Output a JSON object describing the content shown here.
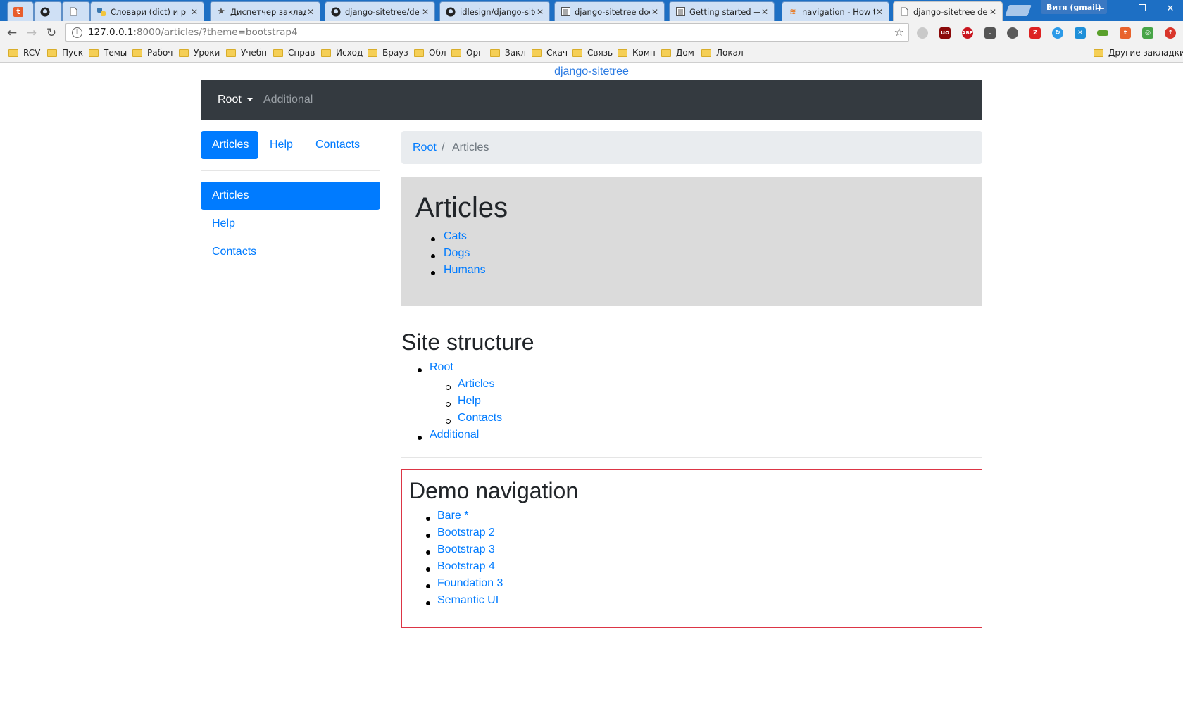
{
  "browser": {
    "tabs": [
      {
        "title": "",
        "icon": "t"
      },
      {
        "title": "",
        "icon": "github"
      },
      {
        "title": "",
        "icon": "page"
      },
      {
        "title": "Словари (dict) и р",
        "icon": "python"
      },
      {
        "title": "Диспетчер заклад",
        "icon": "star"
      },
      {
        "title": "django-sitetree/de",
        "icon": "github"
      },
      {
        "title": "idlesign/django-site",
        "icon": "github"
      },
      {
        "title": "django-sitetree doc",
        "icon": "doc"
      },
      {
        "title": "Getting started — c",
        "icon": "doc"
      },
      {
        "title": "navigation - How t",
        "icon": "stack"
      },
      {
        "title": "django-sitetree dei",
        "icon": "page"
      }
    ],
    "profile_label": "Витя (gmail)",
    "window_controls": {
      "minimize": "—",
      "restore": "❐",
      "close": "✕"
    },
    "url_host": "127.0.0.1",
    "url_path": ":8000/articles/?theme=bootstrap4",
    "bookmarks": [
      "RCV",
      "Пуск",
      "Темы",
      "Рабоч",
      "Уроки",
      "Учебн",
      "Справ",
      "Исход",
      "Брауз",
      "Обл",
      "Орг",
      "Закл",
      "Скач",
      "Связь",
      "Комп",
      "Дом",
      "Локал"
    ],
    "other_bookmarks": "Другие закладки"
  },
  "page": {
    "brand": "django-sitetree",
    "topnav": {
      "root": "Root",
      "additional": "Additional"
    },
    "pills": [
      "Articles",
      "Help",
      "Contacts"
    ],
    "sidebar": [
      "Articles",
      "Help",
      "Contacts"
    ],
    "breadcrumb": {
      "root": "Root",
      "sep": "/",
      "current": "Articles"
    },
    "articles": {
      "title": "Articles",
      "items": [
        "Cats",
        "Dogs",
        "Humans"
      ]
    },
    "site_structure": {
      "title": "Site structure",
      "root": "Root",
      "children": [
        "Articles",
        "Help",
        "Contacts"
      ],
      "additional": "Additional"
    },
    "demo": {
      "title": "Demo navigation",
      "items": [
        "Bare *",
        "Bootstrap 2",
        "Bootstrap 3",
        "Bootstrap 4",
        "Foundation 3",
        "Semantic UI"
      ]
    },
    "colors": {
      "primary": "#007bff",
      "navbar": "#343a40",
      "jumbotron": "#dbdbdb",
      "demo_border": "#dc3545"
    }
  }
}
